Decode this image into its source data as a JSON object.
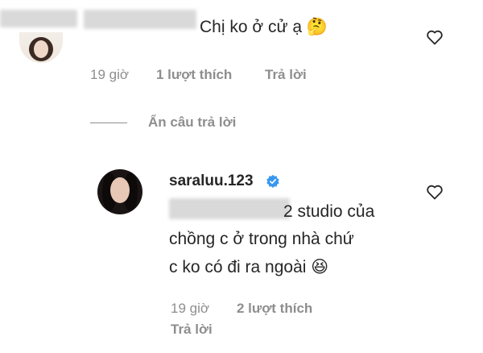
{
  "comment1": {
    "text": "Chị ko ở cử ạ",
    "emoji": "🤔",
    "time": "19 giờ",
    "likes": "1 lượt thích",
    "reply": "Trả lời"
  },
  "hide_replies": "Ẩn câu trả lời",
  "reply1": {
    "username": "saraluu.123",
    "text_line1": "2 studio của",
    "text_line2": "chồng c ở trong nhà chứ",
    "text_line3": "c ko có đi ra ngoài",
    "emoji": "😆",
    "time": "19 giờ",
    "likes": "2 lượt thích",
    "reply": "Trả lời"
  },
  "icons": {
    "heart": "heart-icon",
    "verified": "verified-badge-icon"
  },
  "colors": {
    "text": "#262626",
    "secondary": "#8e8e8e",
    "verified": "#3897f0"
  }
}
